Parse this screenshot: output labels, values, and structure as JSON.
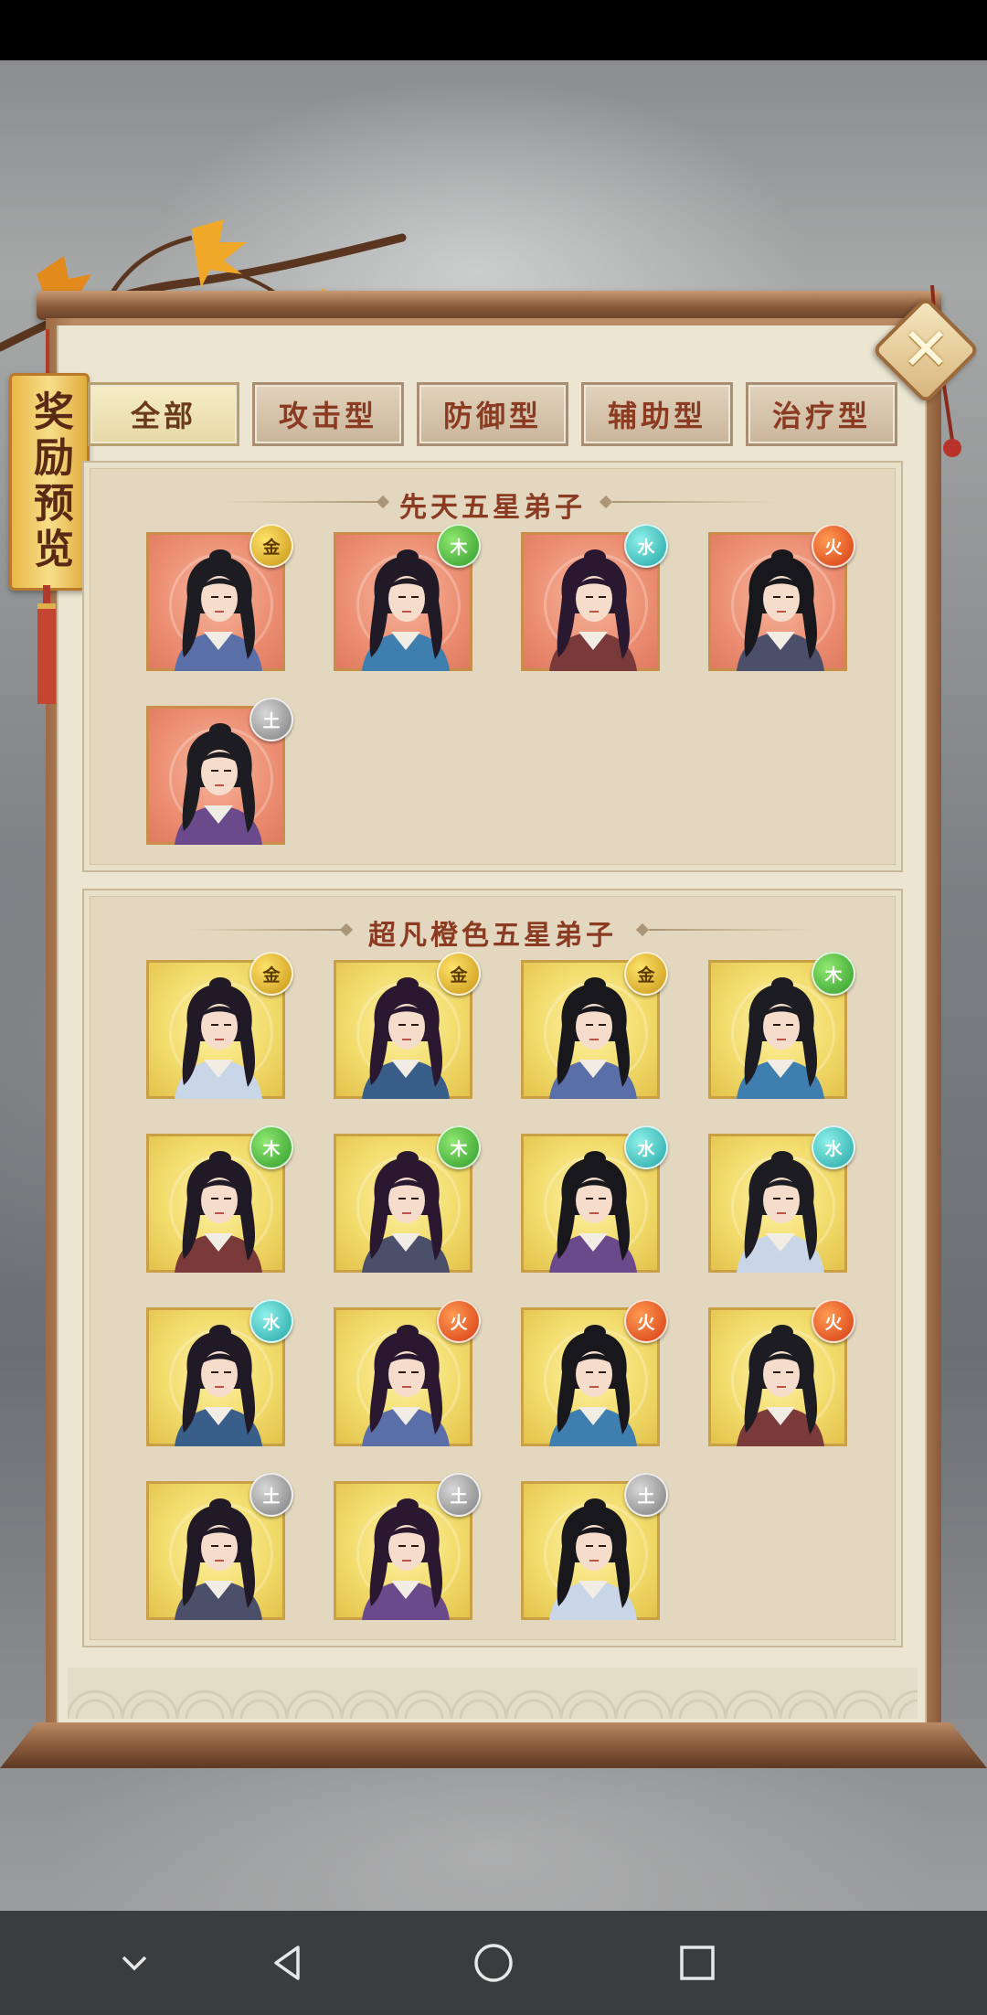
{
  "sidebar": {
    "banner_label": "奖励预览"
  },
  "tabs": [
    {
      "label": "全部",
      "active": true
    },
    {
      "label": "攻击型",
      "active": false
    },
    {
      "label": "防御型",
      "active": false
    },
    {
      "label": "辅助型",
      "active": false
    },
    {
      "label": "治疗型",
      "active": false
    }
  ],
  "sections": [
    {
      "title": "先天五星弟子",
      "card_style": "red",
      "characters": [
        {
          "element": "金"
        },
        {
          "element": "木"
        },
        {
          "element": "水"
        },
        {
          "element": "火"
        },
        {
          "element": "土"
        }
      ]
    },
    {
      "title": "超凡橙色五星弟子",
      "card_style": "gold",
      "characters": [
        {
          "element": "金"
        },
        {
          "element": "金"
        },
        {
          "element": "金"
        },
        {
          "element": "木"
        },
        {
          "element": "木"
        },
        {
          "element": "木"
        },
        {
          "element": "水"
        },
        {
          "element": "水"
        },
        {
          "element": "水"
        },
        {
          "element": "火"
        },
        {
          "element": "火"
        },
        {
          "element": "火"
        },
        {
          "element": "土"
        },
        {
          "element": "土"
        },
        {
          "element": "土"
        }
      ]
    }
  ],
  "element_colors": {
    "金": "#d8a51c",
    "木": "#3aa62f",
    "水": "#2ab1ae",
    "火": "#e04a18",
    "土": "#8a8a8a"
  },
  "icons": {
    "close": "close-icon",
    "nav": [
      "chevron-down-icon",
      "back-icon",
      "home-icon",
      "recents-icon"
    ]
  }
}
